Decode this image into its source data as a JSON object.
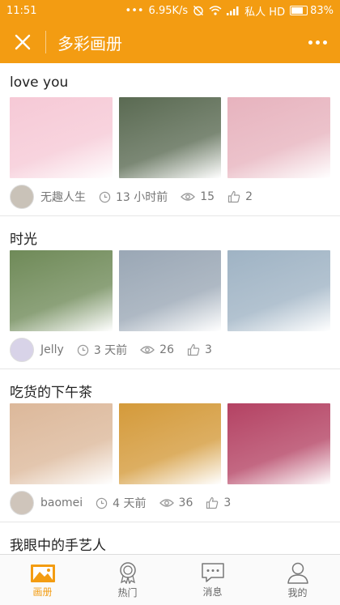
{
  "status": {
    "time": "11:51",
    "dots": "•••",
    "speed": "6.95K/s",
    "carrier": "私人 HD",
    "battery": "83%",
    "battery_level": 0.83
  },
  "header": {
    "title": "多彩画册"
  },
  "albums": [
    {
      "title": "love you",
      "user": "无趣人生",
      "time": "13 小时前",
      "views": "15",
      "likes": "2",
      "photo_colors": [
        "#f6c9d6",
        "#5a6a52",
        "#e7b3be"
      ],
      "avatar_color": "#c9c2b8"
    },
    {
      "title": "时光",
      "user": "Jelly",
      "time": "3 天前",
      "views": "26",
      "likes": "3",
      "photo_colors": [
        "#6f8a58",
        "#9aa7b5",
        "#9fb3c4"
      ],
      "avatar_color": "#d8d3e8"
    },
    {
      "title": "吃货的下午茶",
      "user": "baomei",
      "time": "4 天前",
      "views": "36",
      "likes": "3",
      "photo_colors": [
        "#dcb89a",
        "#d49a3a",
        "#b44263"
      ],
      "avatar_color": "#cfc5bb"
    },
    {
      "title": "我眼中的手艺人"
    }
  ],
  "tabs": [
    {
      "label": "画册",
      "icon": "album-icon",
      "active": true
    },
    {
      "label": "热门",
      "icon": "badge-icon",
      "active": false
    },
    {
      "label": "消息",
      "icon": "message-icon",
      "active": false
    },
    {
      "label": "我的",
      "icon": "user-icon",
      "active": false
    }
  ],
  "colors": {
    "accent": "#f39c12"
  }
}
